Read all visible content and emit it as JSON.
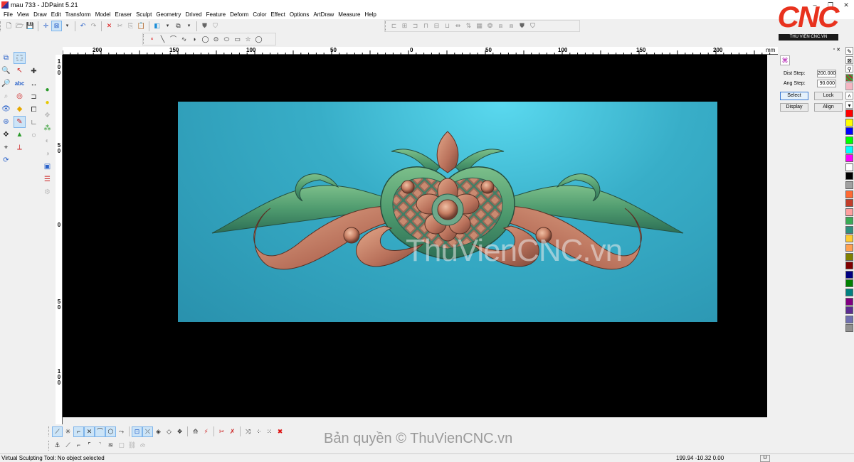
{
  "window": {
    "title": "mau 733 - JDPaint 5.21",
    "controls": [
      "–",
      "❐",
      "✕"
    ]
  },
  "menu": [
    "File",
    "View",
    "Draw",
    "Edit",
    "Transform",
    "Model",
    "Eraser",
    "Sculpt",
    "Geometry",
    "Drived",
    "Feature",
    "Deform",
    "Color",
    "Effect",
    "Options",
    "ArtDraw",
    "Measure",
    "Help"
  ],
  "logo": {
    "brand": "CNC",
    "subtitle": "THU VIEN CNC.VN"
  },
  "ruler": {
    "unit": "mm",
    "top_labels": [
      "200",
      "150",
      "100",
      "50",
      "0",
      "50",
      "100",
      "150",
      "200"
    ],
    "left_labels": [
      "1\n0\n0",
      "5\n0",
      "0",
      "5\n0",
      "1\n0\n0"
    ]
  },
  "viewport": {
    "watermark": "ThuVienCNC.vn"
  },
  "params": {
    "dist_step_label": "Dist Step:",
    "dist_step_value": "200.000",
    "ang_step_label": "Ang Step:",
    "ang_step_value": "90.000",
    "buttons": [
      "Select",
      "Lock",
      "Display",
      "Align"
    ]
  },
  "palette": [
    "#ff0000",
    "#ffff00",
    "#0000ff",
    "#00ff00",
    "#00ffff",
    "#ff00ff",
    "#ffffff",
    "#000000",
    "#a0a0a0",
    "#ff6a33",
    "#c23d2a",
    "#ff9f9f",
    "#3aaa55",
    "#2f8f7f",
    "#ffcc33",
    "#ffa050",
    "#808000",
    "#800000",
    "#000080",
    "#008000",
    "#008080",
    "#800080",
    "#5c2d91",
    "#7070b0",
    "#909090"
  ],
  "copyright": "Bản quyền © ThuVienCNC.vn",
  "status": {
    "message": "Virtual Sculpting Tool: No object selected",
    "coords": "199.94 -10.32 0.00",
    "unit": "U"
  }
}
